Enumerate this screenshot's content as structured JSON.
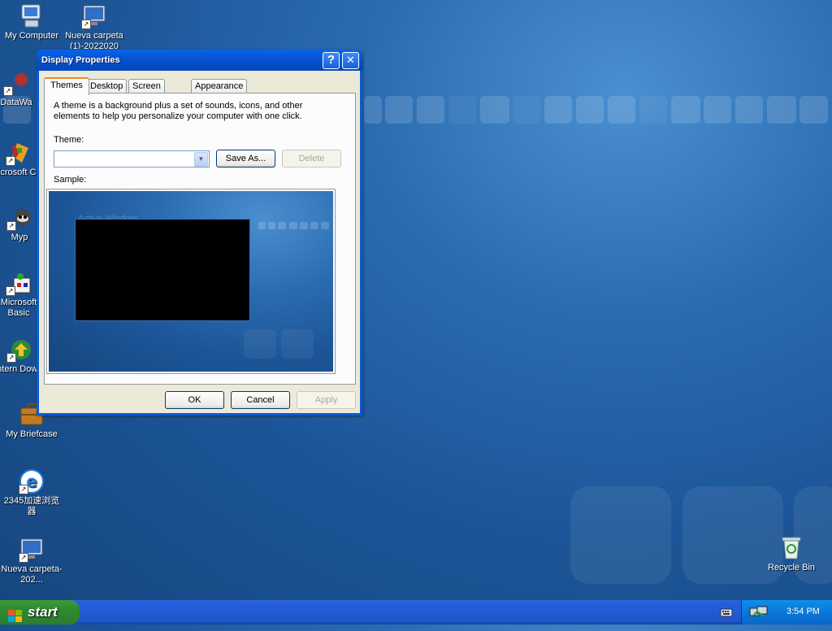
{
  "desktop": {
    "icons": [
      {
        "label": "My Computer"
      },
      {
        "label": "Nueva carpeta (1)-2022020"
      },
      {
        "label": "DataWa"
      },
      {
        "label": "Microsoft C++"
      },
      {
        "label": "Myp"
      },
      {
        "label": "Microsoft Basic"
      },
      {
        "label": "Intern Downl"
      },
      {
        "label": "My Briefcase"
      },
      {
        "label": "2345加速浏览器"
      },
      {
        "label": "Nueva carpeta-202..."
      },
      {
        "label": "Recycle Bin"
      }
    ]
  },
  "dialog": {
    "title": "Display Properties",
    "help_glyph": "?",
    "close_glyph": "✕",
    "tabs": [
      "Themes",
      "Desktop",
      "Screen Saver",
      "Appearance"
    ],
    "description": "A theme is a background plus a set of sounds, icons, and other elements to help you personalize your computer with one click.",
    "theme_label": "Theme:",
    "theme_value": "",
    "save_as_label": "Save As...",
    "delete_label": "Delete",
    "sample_label": "Sample:",
    "sample_window_title": "Active Window",
    "ok_label": "OK",
    "cancel_label": "Cancel",
    "apply_label": "Apply"
  },
  "taskbar": {
    "start_label": "start",
    "clock": "3:54 PM"
  },
  "colors": {
    "desktop_blue": "#1c5597",
    "titlebar": "#0554d4",
    "dialog_face": "#ece9d8",
    "start_green": "#2f8a2f",
    "tray_blue": "#0b77d8"
  }
}
